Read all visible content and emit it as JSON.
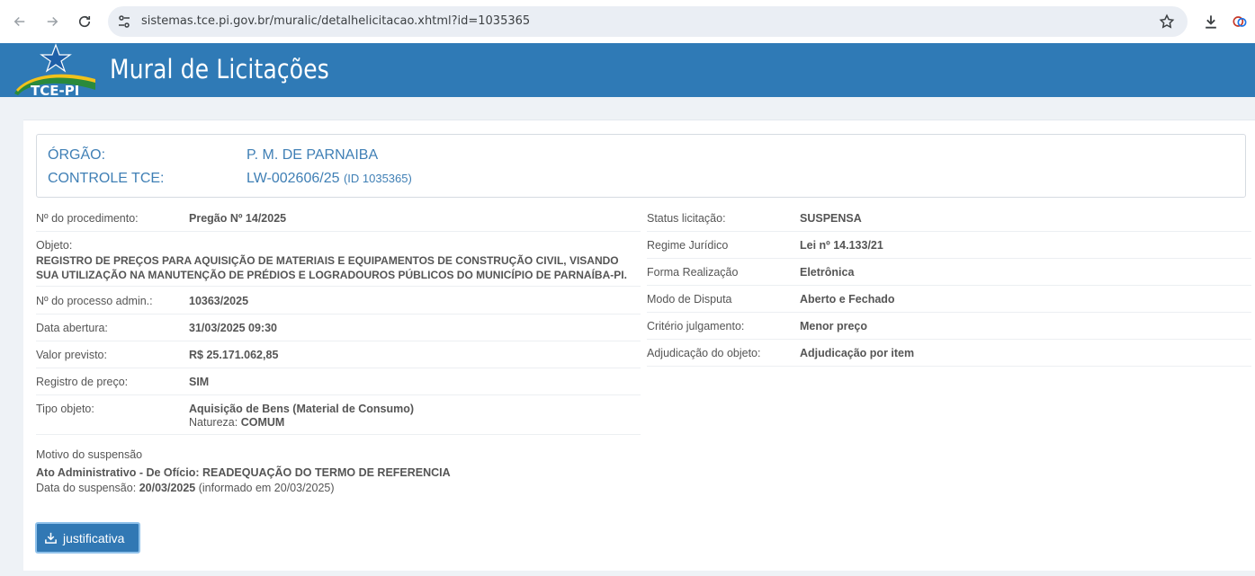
{
  "browser": {
    "url": "sistemas.tce.pi.gov.br/muralic/detalhelicitacao.xhtml?id=1035365"
  },
  "header": {
    "logo_text": "TCE-PI",
    "title": "Mural de Licitações"
  },
  "org": {
    "orgao_label": "ÓRGÃO:",
    "orgao_value": "P. M. DE PARNAIBA",
    "controle_label": "CONTROLE TCE:",
    "controle_value": "LW-002606/25",
    "controle_id": "(ID 1035365)"
  },
  "left": {
    "procedimento_label": "Nº do procedimento:",
    "procedimento_value": "Pregão Nº 14/2025",
    "objeto_label": "Objeto:",
    "objeto_value": "REGISTRO DE PREÇOS PARA AQUISIÇÃO DE MATERIAIS E EQUIPAMENTOS DE CONSTRUÇÃO CIVIL, VISANDO SUA UTILIZAÇÃO NA MANUTENÇÃO DE PRÉDIOS E LOGRADOUROS PÚBLICOS DO MUNICÍPIO DE PARNAÍBA-PI.",
    "processo_label": "Nº do processo admin.:",
    "processo_value": "10363/2025",
    "abertura_label": "Data abertura:",
    "abertura_value": "31/03/2025 09:30",
    "valor_label": "Valor previsto:",
    "valor_value": "R$ 25.171.062,85",
    "registro_label": "Registro de preço:",
    "registro_value": "SIM",
    "tipo_label": "Tipo objeto:",
    "tipo_value": "Aquisição de Bens (Material de Consumo)",
    "natureza_label": "Natureza:",
    "natureza_value": "COMUM"
  },
  "right": {
    "status_label": "Status licitação:",
    "status_value": "SUSPENSA",
    "regime_label": "Regime Jurídico",
    "regime_value": "Lei nº 14.133/21",
    "forma_label": "Forma Realização",
    "forma_value": "Eletrônica",
    "modo_label": "Modo de Disputa",
    "modo_value": "Aberto e Fechado",
    "criterio_label": "Critério julgamento:",
    "criterio_value": "Menor preço",
    "adjudicacao_label": "Adjudicação do objeto:",
    "adjudicacao_value": "Adjudicação por item"
  },
  "suspensao": {
    "motivo_label": "Motivo do suspensão",
    "ato": "Ato Administrativo - De Ofício: READEQUAÇÃO DO TERMO DE REFERENCIA",
    "data_label": "Data do suspensão:",
    "data_value": "20/03/2025",
    "informado": "(informado em 20/03/2025)"
  },
  "buttons": {
    "justificativa": "justificativa"
  }
}
